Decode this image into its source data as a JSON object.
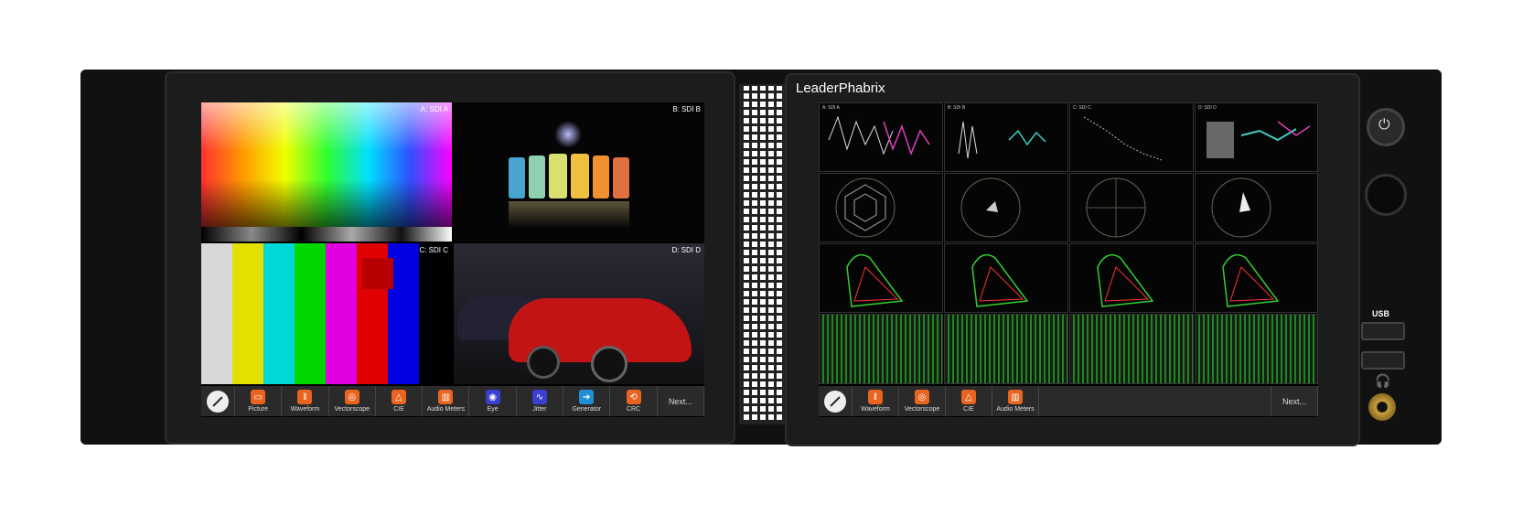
{
  "device": {
    "brand": "LeaderPhabrix"
  },
  "left_screen": {
    "quad_labels": [
      "A: SDI A",
      "B: SDI B",
      "C: SDI C",
      "D: SDI D"
    ],
    "toolbar": [
      {
        "label": "Picture",
        "icon": "picture-icon",
        "color": "#e8641f"
      },
      {
        "label": "Waveform",
        "icon": "waveform-icon",
        "color": "#e8641f"
      },
      {
        "label": "Vectorscope",
        "icon": "vectorscope-icon",
        "color": "#e8641f"
      },
      {
        "label": "CIE",
        "icon": "cie-icon",
        "color": "#e8641f"
      },
      {
        "label": "Audio Meters",
        "icon": "audio-meters-icon",
        "color": "#e8641f"
      },
      {
        "label": "Eye",
        "icon": "eye-icon",
        "color": "#3b3fd0"
      },
      {
        "label": "Jitter",
        "icon": "jitter-icon",
        "color": "#3b3fd0"
      },
      {
        "label": "Generator",
        "icon": "generator-icon",
        "color": "#1f8fd6"
      },
      {
        "label": "CRC",
        "icon": "crc-icon",
        "color": "#e8641f"
      },
      {
        "label": "Next...",
        "icon": "",
        "color": ""
      }
    ]
  },
  "right_screen": {
    "row_labels": [
      [
        "A: SDI A",
        "B: SDI B",
        "C: SDI C",
        "D: SDI D"
      ]
    ],
    "toolbar": [
      {
        "label": "Waveform",
        "icon": "waveform-icon",
        "color": "#e8641f"
      },
      {
        "label": "Vectorscope",
        "icon": "vectorscope-icon",
        "color": "#e8641f"
      },
      {
        "label": "CIE",
        "icon": "cie-icon",
        "color": "#e8641f"
      },
      {
        "label": "Audio Meters",
        "icon": "audio-meters-icon",
        "color": "#e8641f"
      }
    ],
    "next_label": "Next..."
  },
  "controls": {
    "usb_label": "USB"
  },
  "colors": {
    "accent_orange": "#e8641f",
    "accent_blue": "#3b3fd0",
    "chassis": "#111111"
  }
}
